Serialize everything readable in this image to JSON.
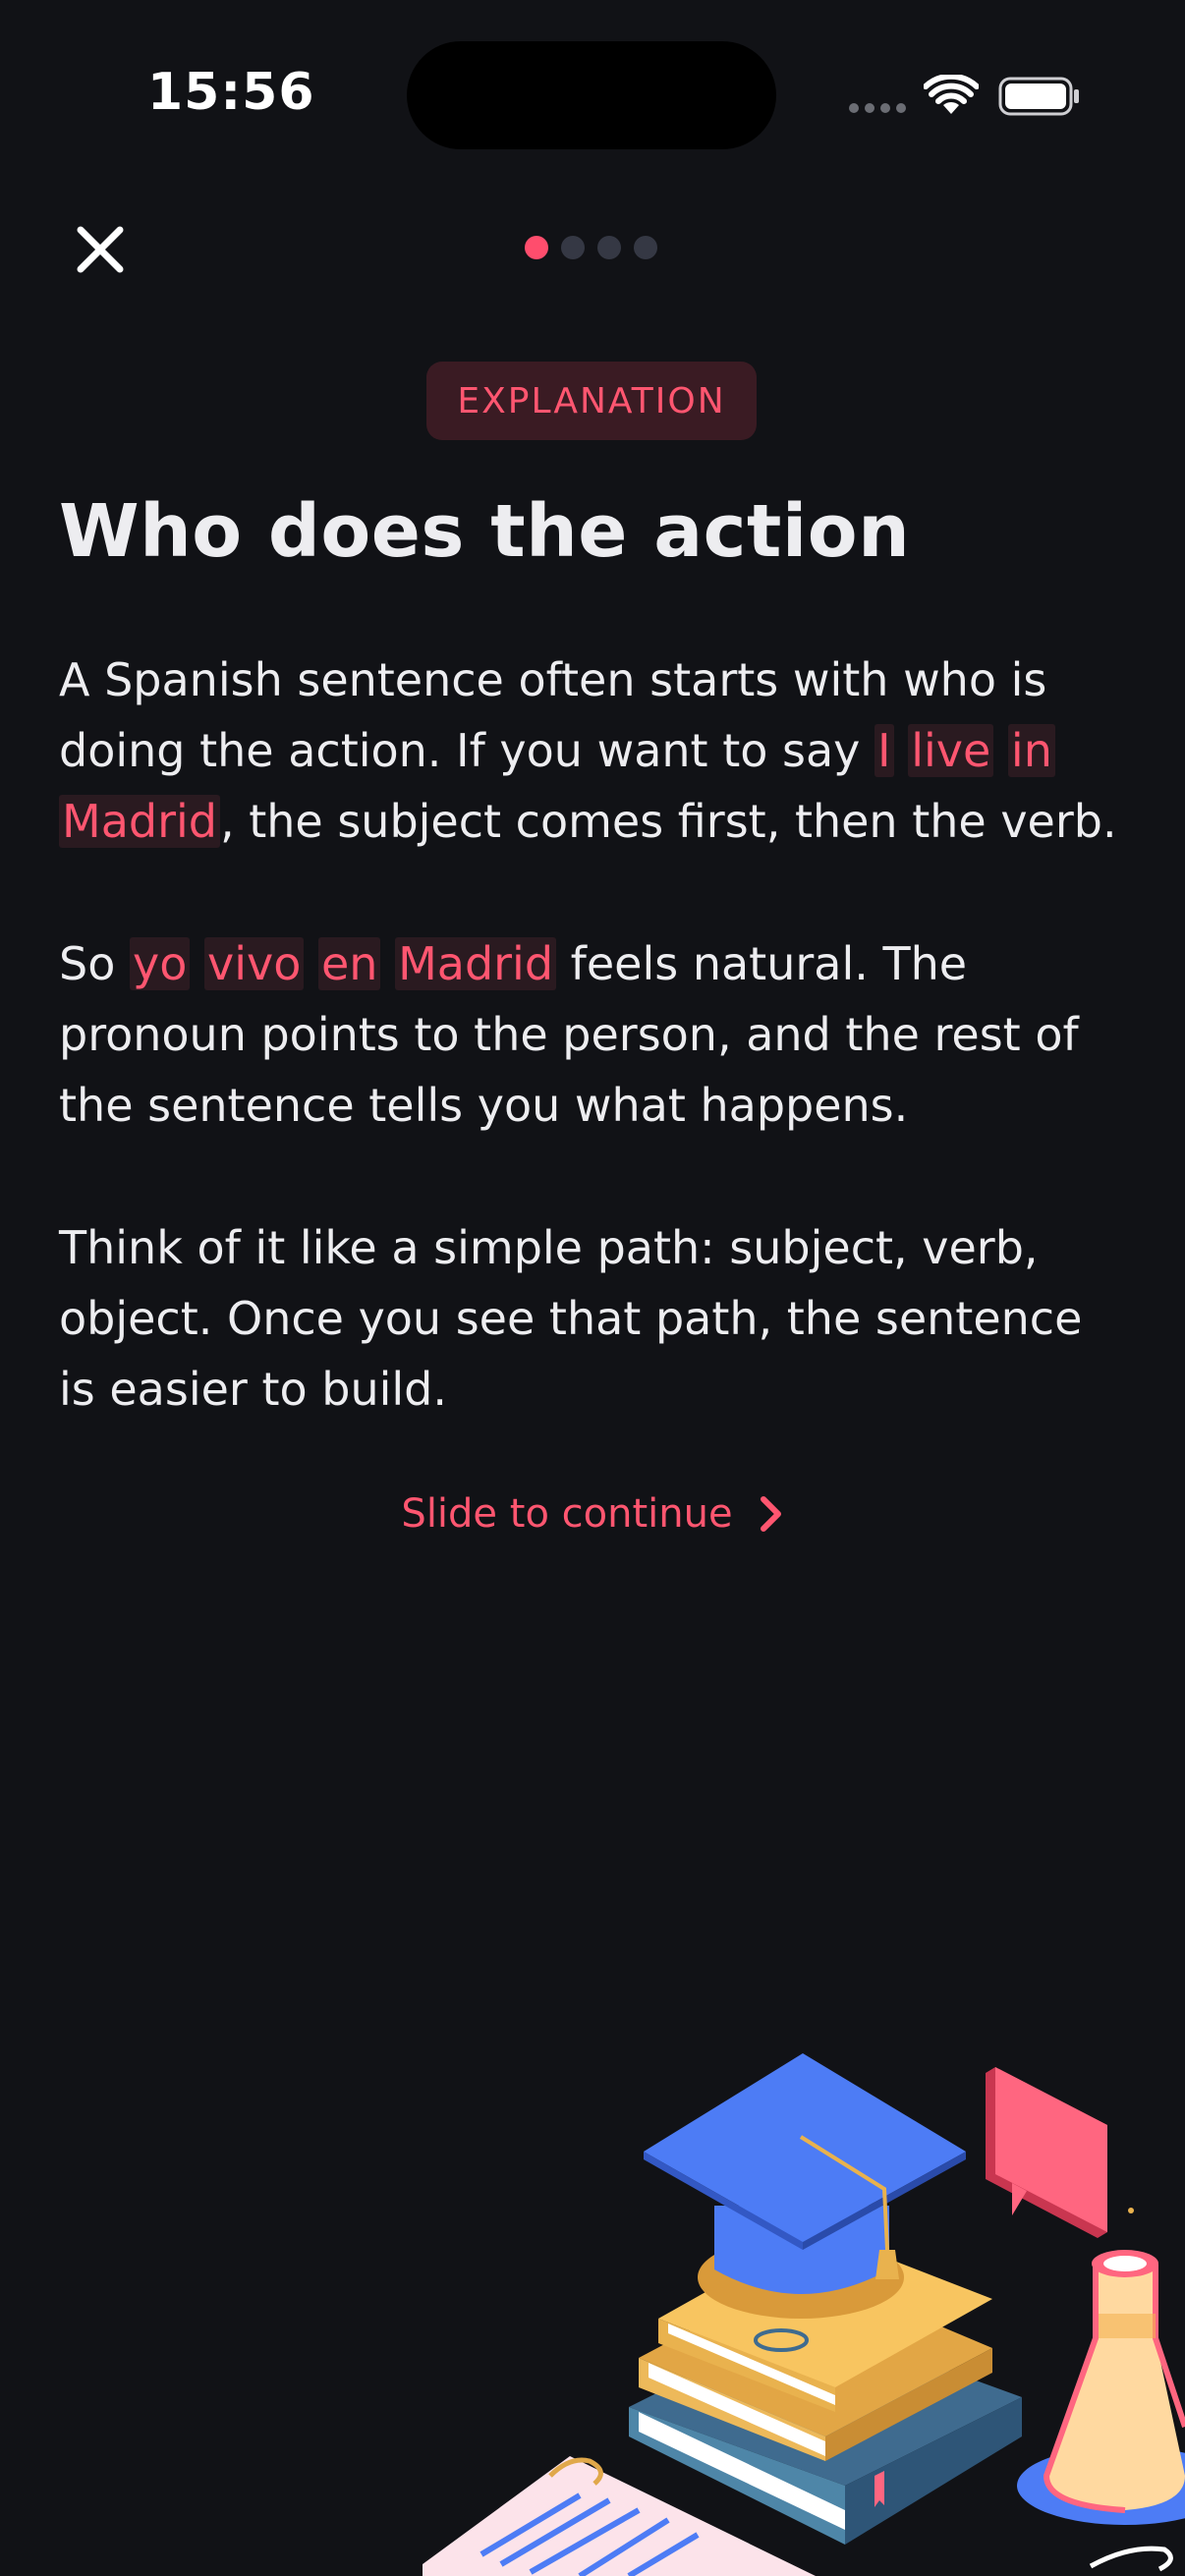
{
  "status_bar": {
    "time": "15:56"
  },
  "nav": {
    "close_icon": "close-icon",
    "pages_total": 4,
    "page_current": 1
  },
  "badge": "EXPLANATION",
  "title": "Who does the action",
  "paragraphs": {
    "p1": {
      "a": "A Spanish sentence often starts with who is doing the action. If you want to say ",
      "h1": "I",
      "h2": "live",
      "h3": "in",
      "h4": "Madrid",
      "b": ", the subject comes first, then the verb."
    },
    "p2": {
      "a": "So ",
      "h1": "yo",
      "h2": "vivo",
      "h3": "en",
      "h4": "Madrid",
      "b": " feels natural. The pronoun points to the person, and the rest of the sentence tells you what happens."
    },
    "p3": "Think of it like a simple path: subject, verb, object. Once you see that path, the sentence is easier to build."
  },
  "continue": {
    "label": "Slide to continue",
    "icon": "chevron-right-icon"
  },
  "colors": {
    "background": "#111216",
    "accent": "#FF4D6D",
    "text": "#EDEDF0",
    "highlight_bg": "#2A1A20"
  }
}
